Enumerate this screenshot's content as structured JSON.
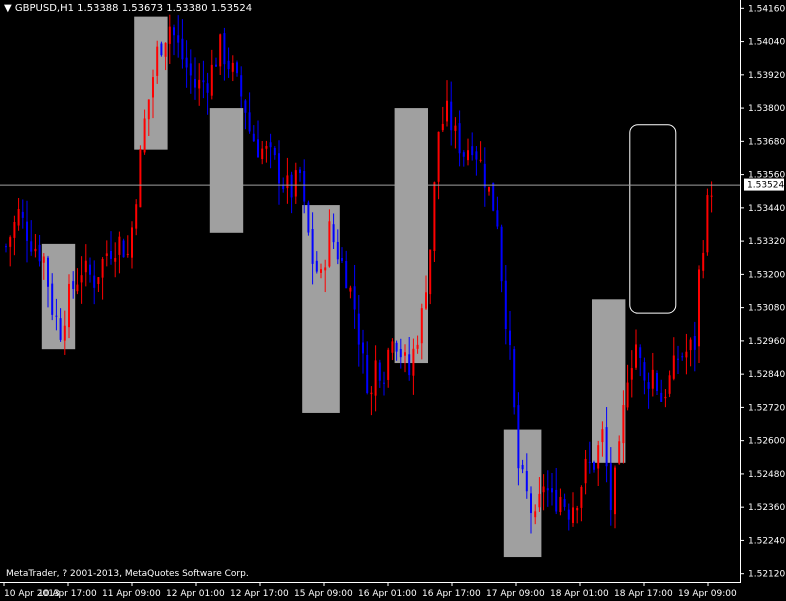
{
  "header": {
    "symbol": "GBPUSD,H1",
    "ohlc": "1.53388 1.53673 1.53380 1.53524"
  },
  "copyright": "MetaTrader, ? 2001-2013, MetaQuotes Software Corp.",
  "colors": {
    "background": "#000000",
    "bull": "#ff0000",
    "bear": "#0000ff",
    "box": "#a0a0a0",
    "axis": "#ffffff",
    "price_line": "#a0a0a0"
  },
  "chart_data": {
    "type": "candlestick",
    "symbol": "GBPUSD",
    "timeframe": "H1",
    "y_ticks": [
      "1.54160",
      "1.54040",
      "1.53920",
      "1.53800",
      "1.53680",
      "1.53560",
      "1.53440",
      "1.53320",
      "1.53200",
      "1.53080",
      "1.52960",
      "1.52840",
      "1.52720",
      "1.52600",
      "1.52480",
      "1.52360",
      "1.52240",
      "1.52120"
    ],
    "x_ticks": [
      "10 Apr 2013",
      "10 Apr 17:00",
      "11 Apr 09:00",
      "12 Apr 01:00",
      "12 Apr 17:00",
      "15 Apr 09:00",
      "16 Apr 01:00",
      "16 Apr 17:00",
      "17 Apr 09:00",
      "18 Apr 01:00",
      "18 Apr 17:00",
      "19 Apr 09:00"
    ],
    "ylim": [
      1.5209,
      1.5419
    ],
    "current_price": "1.53524",
    "price_path": [
      [
        0,
        1.533
      ],
      [
        3,
        1.5342
      ],
      [
        6,
        1.5332
      ],
      [
        9,
        1.5326
      ],
      [
        11,
        1.5308
      ],
      [
        13,
        1.53
      ],
      [
        15,
        1.5312
      ],
      [
        18,
        1.5322
      ],
      [
        21,
        1.5318
      ],
      [
        24,
        1.5328
      ],
      [
        27,
        1.5332
      ],
      [
        29,
        1.5327
      ],
      [
        30,
        1.5337
      ],
      [
        33,
        1.5375
      ],
      [
        36,
        1.54
      ],
      [
        39,
        1.541
      ],
      [
        42,
        1.5398
      ],
      [
        45,
        1.5388
      ],
      [
        48,
        1.539
      ],
      [
        51,
        1.5402
      ],
      [
        54,
        1.5393
      ],
      [
        57,
        1.538
      ],
      [
        58,
        1.5372
      ],
      [
        60,
        1.5366
      ],
      [
        62,
        1.5364
      ],
      [
        64,
        1.536
      ],
      [
        66,
        1.5353
      ],
      [
        68,
        1.535
      ],
      [
        70,
        1.5356
      ],
      [
        71,
        1.5343
      ],
      [
        73,
        1.5325
      ],
      [
        75,
        1.5318
      ],
      [
        77,
        1.5336
      ],
      [
        79,
        1.5328
      ],
      [
        81,
        1.532
      ],
      [
        83,
        1.5308
      ],
      [
        85,
        1.5288
      ],
      [
        87,
        1.5276
      ],
      [
        88,
        1.5288
      ],
      [
        90,
        1.5285
      ],
      [
        92,
        1.53
      ],
      [
        94,
        1.5292
      ],
      [
        96,
        1.5284
      ],
      [
        97,
        1.5292
      ],
      [
        99,
        1.5305
      ],
      [
        101,
        1.533
      ],
      [
        103,
        1.5372
      ],
      [
        105,
        1.5378
      ],
      [
        107,
        1.537
      ],
      [
        109,
        1.5364
      ],
      [
        111,
        1.5368
      ],
      [
        113,
        1.536
      ],
      [
        115,
        1.535
      ],
      [
        117,
        1.534
      ],
      [
        118,
        1.532
      ],
      [
        120,
        1.529
      ],
      [
        122,
        1.525
      ],
      [
        124,
        1.524
      ],
      [
        126,
        1.523
      ],
      [
        128,
        1.5245
      ],
      [
        130,
        1.5238
      ],
      [
        132,
        1.524
      ],
      [
        134,
        1.5235
      ],
      [
        136,
        1.524
      ],
      [
        138,
        1.525
      ],
      [
        140,
        1.5252
      ],
      [
        142,
        1.5262
      ],
      [
        143,
        1.525
      ],
      [
        144,
        1.5236
      ],
      [
        146,
        1.5255
      ],
      [
        148,
        1.5285
      ],
      [
        150,
        1.5295
      ],
      [
        152,
        1.528
      ],
      [
        154,
        1.5285
      ],
      [
        156,
        1.5275
      ],
      [
        158,
        1.5282
      ],
      [
        160,
        1.529
      ],
      [
        162,
        1.5292
      ],
      [
        164,
        1.5295
      ],
      [
        165,
        1.532
      ],
      [
        167,
        1.5345
      ],
      [
        168,
        1.5352
      ]
    ],
    "boxes": [
      {
        "from": 9,
        "to": 16,
        "low": 1.5293,
        "high": 1.5331
      },
      {
        "from": 31,
        "to": 38,
        "low": 1.5365,
        "high": 1.5413
      },
      {
        "from": 49,
        "to": 56,
        "low": 1.5335,
        "high": 1.538
      },
      {
        "from": 71,
        "to": 79,
        "low": 1.527,
        "high": 1.5345
      },
      {
        "from": 93,
        "to": 100,
        "low": 1.5288,
        "high": 1.538
      },
      {
        "from": 119,
        "to": 127,
        "low": 1.5218,
        "high": 1.5264
      },
      {
        "from": 140,
        "to": 147,
        "low": 1.5252,
        "high": 1.5311
      }
    ],
    "highlight_box": {
      "from": 149,
      "to": 159,
      "low": 1.5306,
      "high": 1.5374
    },
    "grid": false,
    "legend": "none"
  }
}
